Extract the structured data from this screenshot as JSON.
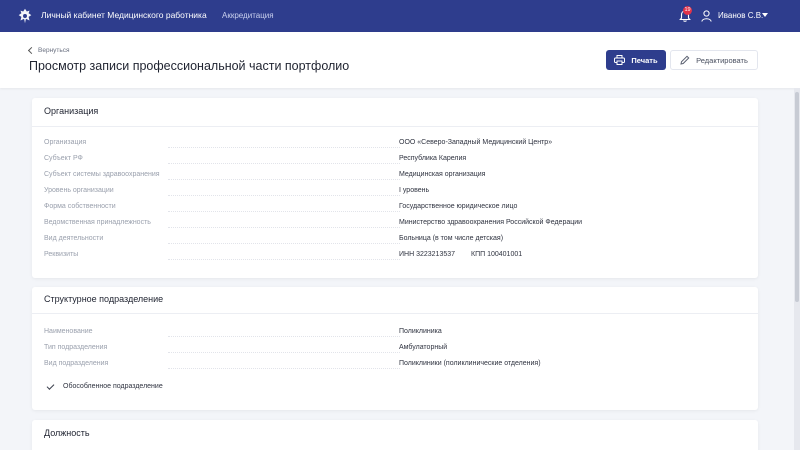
{
  "topbar": {
    "app_title": "Личный кабинет Медицинского работника",
    "nav_link": "Аккредитация",
    "notifications_count": "19",
    "user_name": "Иванов С.В.",
    "bg_color": "#2e3d8d"
  },
  "header": {
    "back_label": "Вернуться",
    "title": "Просмотр записи профессиональной части портфолио",
    "print_label": "Печать",
    "edit_label": "Редактировать"
  },
  "organization": {
    "title": "Организация",
    "rows": [
      {
        "label": "Организация",
        "value": "ООО «Северо-Западный Медицинский Центр»"
      },
      {
        "label": "Субъект РФ",
        "value": "Республика Карелия"
      },
      {
        "label": "Субъект системы здравоохранения",
        "value": "Медицинская организация"
      },
      {
        "label": "Уровень организации",
        "value": "I уровень"
      },
      {
        "label": "Форма собственности",
        "value": "Государственное юридическое лицо"
      },
      {
        "label": "Ведомственная принадлежность",
        "value": "Министерство здравоохранения Российской Федерации"
      },
      {
        "label": "Вид деятельности",
        "value": "Больница (в том числе детская)"
      },
      {
        "label": "Реквизиты",
        "value": "ИНН 3223213537",
        "value2": "КПП 100401001"
      }
    ]
  },
  "structural_unit": {
    "title": "Структурное подразделение",
    "rows": [
      {
        "label": "Наименование",
        "value": "Поликлиника"
      },
      {
        "label": "Тип подразделения",
        "value": "Амбулаторный"
      },
      {
        "label": "Вид подразделения",
        "value": "Поликлиники (поликлинические отделения)"
      }
    ],
    "checkbox_label": "Обособленное подразделение"
  },
  "position": {
    "title": "Должность"
  }
}
